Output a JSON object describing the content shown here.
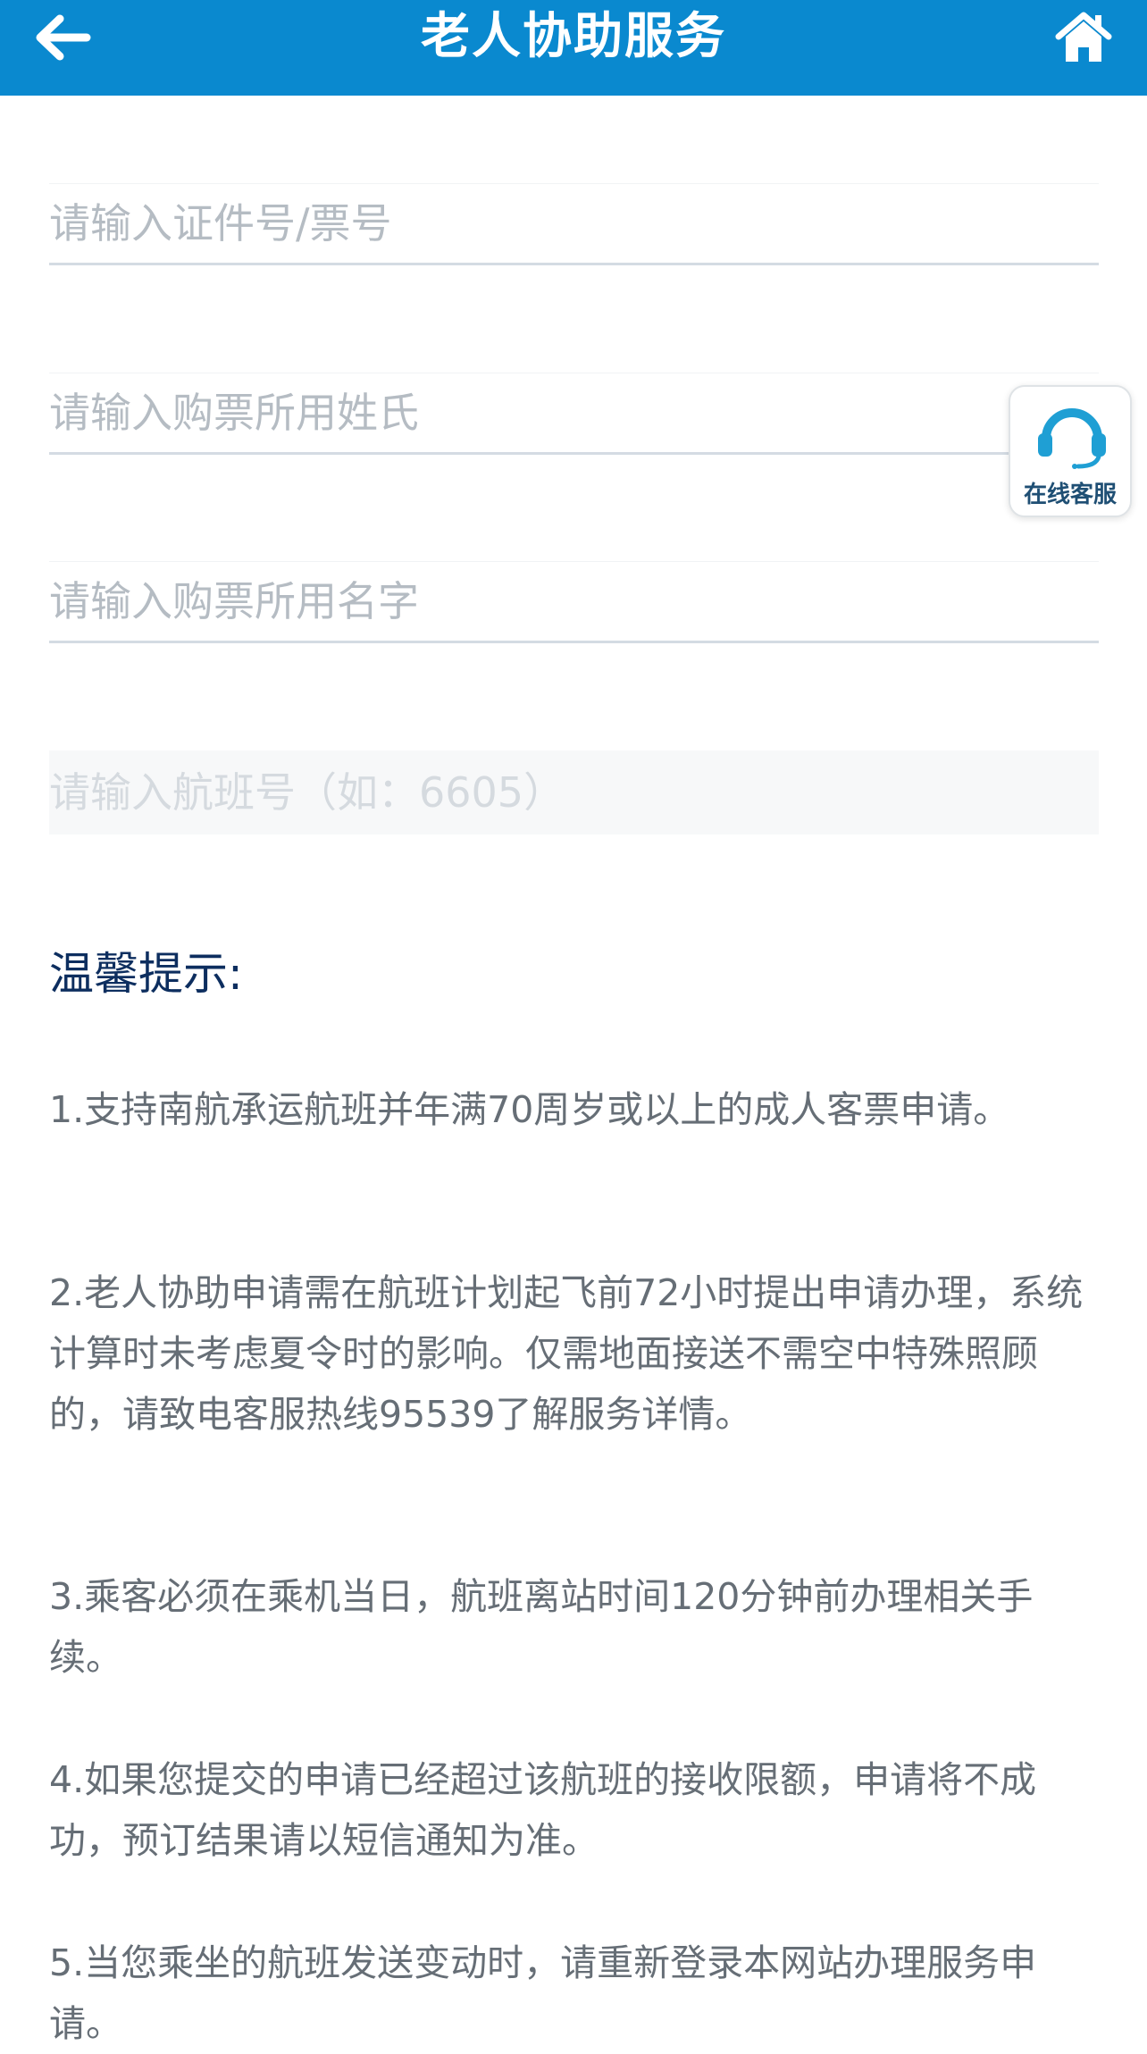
{
  "header": {
    "title": "老人协助服务",
    "background_color": "#0a89cf",
    "back_icon": "arrow-left-icon",
    "home_icon": "home-icon"
  },
  "form": {
    "id_ticket_placeholder": "请输入证件号/票号",
    "surname_placeholder": "请输入购票所用姓氏",
    "given_name_placeholder": "请输入购票所用名字",
    "flight_number_placeholder": "请输入航班号（如：6605）"
  },
  "customer_service": {
    "label": "在线客服",
    "icon": "headset-icon"
  },
  "tips": {
    "title": "温馨提示:",
    "items": [
      "1.支持南航承运航班并年满70周岁或以上的成人客票申请。",
      "2.老人协助申请需在航班计划起飞前72小时提出申请办理，系统计算时未考虑夏令时的影响。仅需地面接送不需空中特殊照顾的，请致电客服热线95539了解服务详情。",
      "3.乘客必须在乘机当日，航班离站时间120分钟前办理相关手续。",
      "4.如果您提交的申请已经超过该航班的接收限额，申请将不成功，预订结果请以短信通知为准。",
      "5.当您乘坐的航班发送变动时，请重新登录本网站办理服务申请。"
    ]
  }
}
